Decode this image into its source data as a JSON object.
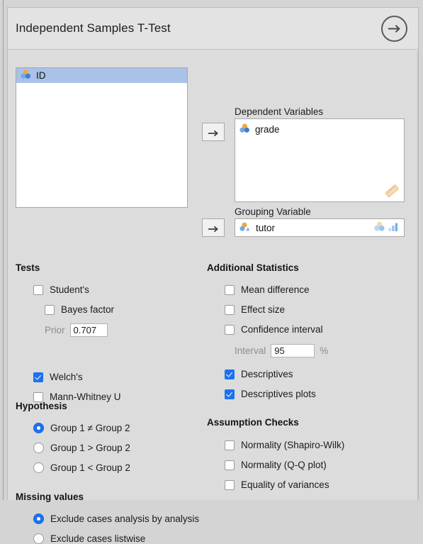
{
  "header": {
    "title": "Independent Samples T-Test",
    "next_icon": "arrow-right-circle-icon"
  },
  "variables_list": {
    "items": [
      {
        "name": "ID",
        "icon": "nominal-variable-icon",
        "selected": true
      }
    ]
  },
  "assigned": {
    "dependent": {
      "label": "Dependent Variables",
      "transfer_icon": "arrow-right-icon",
      "items": [
        {
          "name": "grade",
          "icon": "nominal-variable-icon"
        }
      ],
      "corner_icon": "scale-ruler-icon"
    },
    "grouping": {
      "label": "Grouping Variable",
      "transfer_icon": "arrow-right-icon",
      "items": [
        {
          "name": "tutor",
          "icon": "nominal-text-variable-icon"
        }
      ],
      "allowed_icons": [
        "nominal-variable-icon",
        "ordinal-variable-icon"
      ]
    }
  },
  "tests": {
    "title": "Tests",
    "students": {
      "label": "Student's",
      "checked": false
    },
    "bayes_factor": {
      "label": "Bayes factor",
      "checked": false
    },
    "prior": {
      "label": "Prior",
      "value": "0.707"
    },
    "welch": {
      "label": "Welch's",
      "checked": true
    },
    "mann_whitney": {
      "label": "Mann-Whitney U",
      "checked": false
    }
  },
  "hypothesis": {
    "title": "Hypothesis",
    "options": [
      {
        "label": "Group 1 ≠ Group 2",
        "selected": true
      },
      {
        "label": "Group 1 > Group 2",
        "selected": false
      },
      {
        "label": "Group 1 < Group 2",
        "selected": false
      }
    ]
  },
  "missing_values": {
    "title": "Missing values",
    "options": [
      {
        "label": "Exclude cases analysis by analysis",
        "selected": true
      },
      {
        "label": "Exclude cases listwise",
        "selected": false
      }
    ]
  },
  "additional_statistics": {
    "title": "Additional Statistics",
    "mean_difference": {
      "label": "Mean difference",
      "checked": false
    },
    "effect_size": {
      "label": "Effect size",
      "checked": false
    },
    "confidence_interval": {
      "label": "Confidence interval",
      "checked": false
    },
    "interval": {
      "label": "Interval",
      "value": "95",
      "suffix": "%"
    },
    "descriptives": {
      "label": "Descriptives",
      "checked": true
    },
    "descriptives_plots": {
      "label": "Descriptives plots",
      "checked": true
    }
  },
  "assumption_checks": {
    "title": "Assumption Checks",
    "options": [
      {
        "label": "Normality (Shapiro-Wilk)",
        "checked": false
      },
      {
        "label": "Normality (Q-Q plot)",
        "checked": false
      },
      {
        "label": "Equality of variances",
        "checked": false
      }
    ]
  },
  "colors": {
    "accent": "#1a73ee",
    "panel_bg": "#dcdcdc",
    "titlebar_bg": "#e3e3e3",
    "selection_bg": "#aac2e8",
    "nominal_orange": "#f0a93c",
    "nominal_blue": "#4a8fdc"
  }
}
